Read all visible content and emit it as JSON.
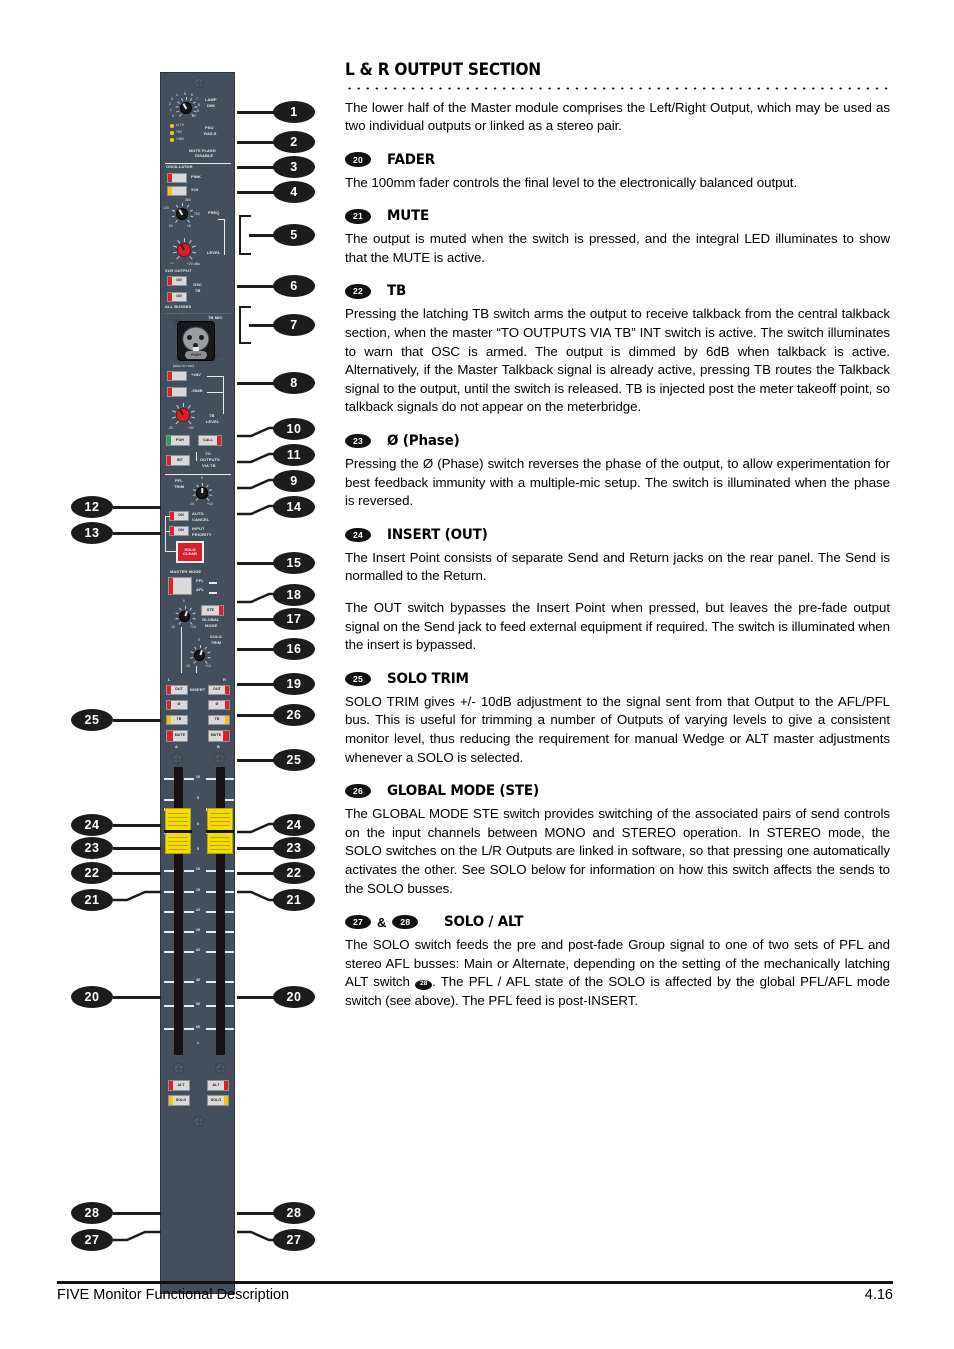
{
  "section": {
    "title": "L & R OUTPUT SECTION",
    "intro": "The lower half of the Master module comprises the Left/Right Output, which may be used as two individual outputs or linked as a stereo pair."
  },
  "items": [
    {
      "number": "20",
      "label": "FADER",
      "paragraphs": [
        "The 100mm fader controls the final level to the electronically balanced output."
      ]
    },
    {
      "number": "21",
      "label": "MUTE",
      "paragraphs": [
        "The output is muted when the switch is pressed, and the integral LED illuminates to show that the MUTE is active."
      ]
    },
    {
      "number": "22",
      "label": "TB",
      "paragraphs": [
        "Pressing the latching TB switch arms the output to receive talkback from the central talkback section, when the master “TO OUTPUTS VIA TB” INT switch is active. The switch illuminates to warn that OSC is armed. The output is dimmed by 6dB when talkback is active. Alternatively, if the Master Talkback signal is already active, pressing TB routes the Talkback signal to the output, until the switch is released.  TB is injected post the meter takeoff point, so talkback signals do not appear on the meterbridge."
      ]
    },
    {
      "number": "23",
      "label": "Ø (Phase)",
      "paragraphs": [
        "Pressing the Ø (Phase) switch reverses the phase of the output, to allow experimentation for best feedback immunity with a multiple-mic setup.  The switch is illuminated when the phase is reversed."
      ]
    },
    {
      "number": "24",
      "label": "INSERT (OUT)",
      "paragraphs": [
        "The Insert Point consists of separate Send and Return jacks on the rear panel.  The Send is normalled to the Return.",
        "The OUT switch bypasses the Insert Point when pressed, but leaves the pre-fade output signal on the Send jack to feed external equipment if required.  The switch is illuminated when the insert is bypassed."
      ]
    },
    {
      "number": "25",
      "label": "SOLO TRIM",
      "paragraphs": [
        "SOLO TRIM gives +/- 10dB adjustment to the signal sent from that Output to the AFL/PFL bus. This is useful for trimming a number of Outputs of varying levels to give a consistent monitor level, thus reducing the requirement for manual Wedge or ALT master adjustments whenever a SOLO is selected."
      ]
    },
    {
      "number": "26",
      "label": "GLOBAL MODE (STE)",
      "paragraphs": [
        "The GLOBAL MODE STE switch provides switching of the associated pairs of send controls on the input channels between MONO and STEREO operation. In STEREO mode, the SOLO switches on the L/R Outputs are linked in software, so that pressing one automatically activates the other. See SOLO below for information on how this switch affects the sends to the SOLO busses."
      ]
    }
  ],
  "solo_alt": {
    "number_a": "27",
    "amp": "&",
    "number_b": "28",
    "label": "SOLO / ALT",
    "text_before": "The SOLO switch feeds the pre and post-fade Group signal to one of two sets of PFL and stereo AFL busses: Main or Alternate, depending on the setting of the mechanically latching ALT switch ",
    "inline_badge": "28",
    "text_after": ". The PFL / AFL state of the SOLO is affected by the global PFL/AFL mode switch (see above). The PFL feed is post-INSERT."
  },
  "panel": {
    "lamp_dim": "LAMP\nDIM",
    "lamp_dim_l1": "LAMP",
    "lamp_dim_l2": "DIM",
    "lamp_ticks": [
      "0",
      "1",
      "2",
      "3",
      "4",
      "5",
      "6",
      "7",
      "8",
      "9",
      "10"
    ],
    "psu_rails_l1": "PSU",
    "psu_rails_l2": "RAILS",
    "psu_leds": [
      "±17V",
      "+5V",
      "+48V"
    ],
    "mute_flash_l1": "MUTE FLASH",
    "mute_flash_l2": "DISABLE",
    "oscillator": "OSCILLATOR",
    "osc_pink": "PINK",
    "osc_x10": "X10",
    "freq": "FREQ",
    "freq_ticks": [
      "120",
      "360",
      "750",
      "1K",
      "63"
    ],
    "level": "LEVEL",
    "level_min": "-∞",
    "level_max": "+20 dBu",
    "xlr_output": "XLR OUTPUT",
    "on": "ON",
    "osc_label": "OSC",
    "tb_label": "TB",
    "all_busses": "ALL BUSSES",
    "tb_mic": "TB MIC",
    "push": "PUSH",
    "also_on_rear": "(also on rear)",
    "phantom": "+48V",
    "pad": "-30dB",
    "tb_level_l1": "TB",
    "tb_level_l2": "LEVEL",
    "tb_level_min": "-20",
    "tb_level_max": "+60",
    "foh": "FOH",
    "call": "CALL",
    "int": "INT",
    "to_outputs_l1": "TO",
    "to_outputs_l2": "OUTPUTS",
    "to_outputs_l3": "VIA TB",
    "pfl_trim_l1": "PFL",
    "pfl_trim_l2": "TRIM",
    "trim_center": "0",
    "trim_min": "-10",
    "trim_max": "+10",
    "auto_cancel_l1": "AUTO",
    "auto_cancel_l2": "CANCEL",
    "input_priority_l1": "INPUT",
    "input_priority_l2": "PRIORITY",
    "solo_clear_l1": "SOLO",
    "solo_clear_l2": "CLEAR",
    "master_mode": "MASTER MODE",
    "pfl": "PFL",
    "afl": "AFL",
    "ste": "STE",
    "global_mode_l1": "GLOBAL",
    "global_mode_l2": "MODE",
    "solo_trim_l1": "SOLO",
    "solo_trim_l2": "TRIM",
    "ch_left": "L",
    "ch_right": "R",
    "insert": "INSERT",
    "out": "OUT",
    "phase": "Ø",
    "tb": "TB",
    "mute": "MUTE",
    "bus_a": "A",
    "bus_b": "B",
    "alt": "ALT",
    "solo": "SOLO",
    "fader_scale": [
      "10",
      "5",
      "0",
      "5",
      "10",
      "15",
      "20",
      "25",
      "30",
      "40",
      "50",
      "60"
    ],
    "fader_inf": "∞"
  },
  "callouts": {
    "right": [
      "1",
      "2",
      "3",
      "4",
      "5",
      "6",
      "7",
      "8",
      "10",
      "11",
      "9",
      "14",
      "15",
      "18",
      "17",
      "16",
      "19",
      "26",
      "25",
      "24",
      "23",
      "22",
      "21",
      "20",
      "28",
      "27"
    ],
    "left": [
      "12",
      "13",
      "25",
      "24",
      "23",
      "22",
      "21",
      "20",
      "28",
      "27"
    ]
  },
  "footer": {
    "left": "FIVE Monitor Functional Description",
    "right": "4.16"
  },
  "colors": {
    "panel": "#434f5c",
    "led_red": "#e02028",
    "led_yellow": "#f3c40a",
    "led_green": "#16a84b",
    "fader_cap": "#f5dc00",
    "knob_red": "#d8202a",
    "callout": "#1c1c1c"
  }
}
